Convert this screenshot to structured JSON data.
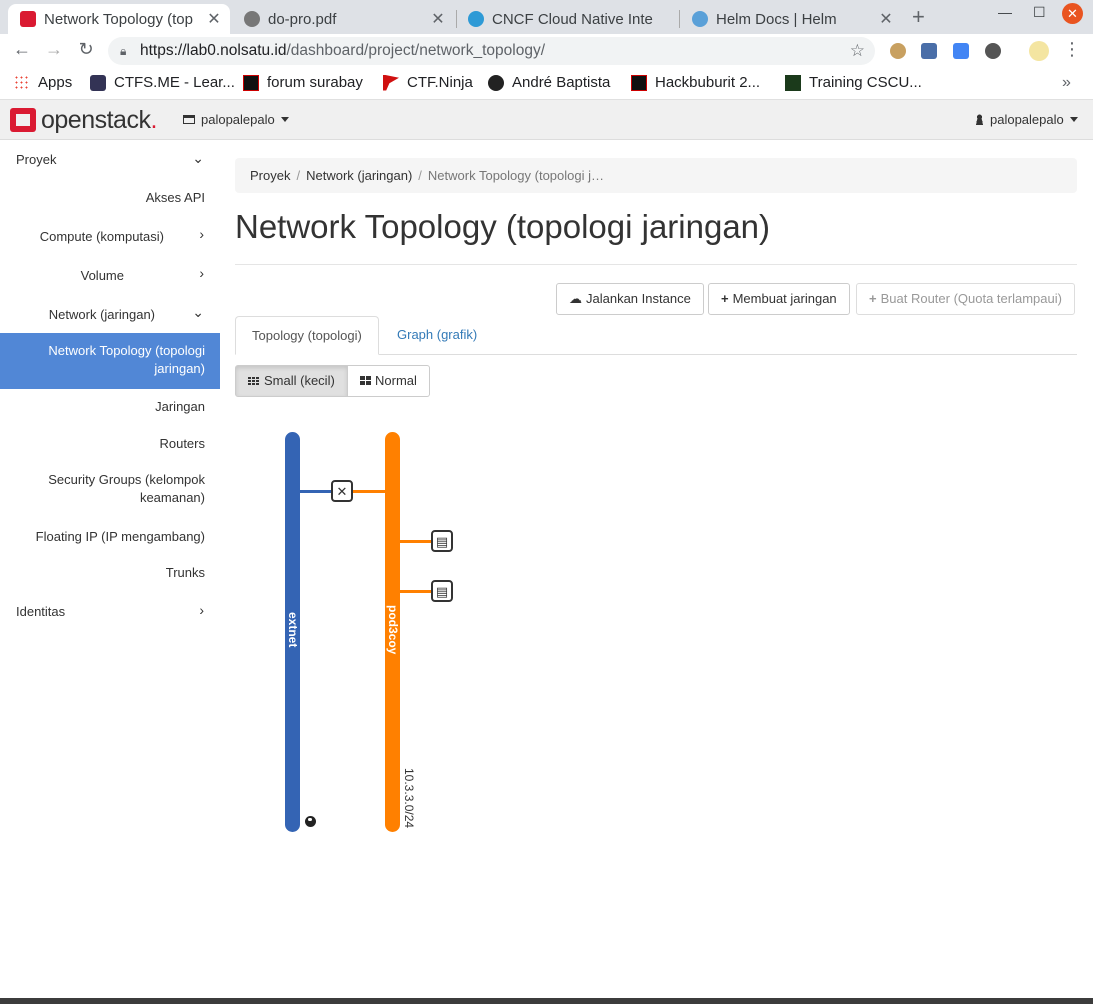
{
  "browser": {
    "tabs": [
      {
        "title": "Network Topology (top",
        "active": true
      },
      {
        "title": "do-pro.pdf",
        "active": false
      },
      {
        "title": "CNCF Cloud Native Inte",
        "active": false
      },
      {
        "title": "Helm Docs | Helm",
        "active": false
      }
    ],
    "url": {
      "host": "https://lab0.nolsatu.id",
      "path": "/dashboard/project/network_topology/"
    },
    "bookmarks": [
      "Apps",
      "CTFS.ME - Lear...",
      "forum surabay",
      "CTF.Ninja",
      "André Baptista",
      "Hackbuburit 2...",
      "Training CSCU..."
    ],
    "bookmarks_more": "»"
  },
  "header": {
    "logo_text": "openstack",
    "project_selector": "palopalepalo",
    "user_selector": "palopalepalo"
  },
  "sidebar": {
    "project": "Proyek",
    "items": [
      {
        "label": "Akses API"
      },
      {
        "label": "Compute (komputasi)"
      },
      {
        "label": "Volume"
      },
      {
        "label": "Network (jaringan)"
      },
      {
        "label": "Network Topology (topologi jaringan)"
      },
      {
        "label": "Jaringan"
      },
      {
        "label": "Routers"
      },
      {
        "label": "Security Groups (kelompok keamanan)"
      },
      {
        "label": "Floating IP (IP mengambang)"
      },
      {
        "label": "Trunks"
      }
    ],
    "identity": "Identitas"
  },
  "breadcrumb": {
    "items": [
      "Proyek",
      "Network (jaringan)",
      "Network Topology (topologi j…"
    ]
  },
  "page": {
    "title": "Network Topology (topologi jaringan)",
    "actions": {
      "launch_instance": "Jalankan Instance",
      "create_network": "Membuat jaringan",
      "create_router": "Buat Router (Quota terlampaui)"
    },
    "tabs": {
      "topology": "Topology (topologi)",
      "graph": "Graph (grafik)"
    },
    "view_toggle": {
      "small": "Small (kecil)",
      "normal": "Normal"
    }
  },
  "topology": {
    "networks": [
      {
        "name": "extnet",
        "color": "#3464b4",
        "external": true
      },
      {
        "name": "pod3coy",
        "color": "#ff8000",
        "cidr": "10.3.3.0/24"
      }
    ],
    "router_icon": "router-icon",
    "instance_icon": "instance-icon",
    "instance_count": 2
  },
  "colors": {
    "accent": "#5187d6",
    "brand": "#da1a32",
    "extnet": "#3464b4",
    "tenant_net": "#ff8000"
  }
}
